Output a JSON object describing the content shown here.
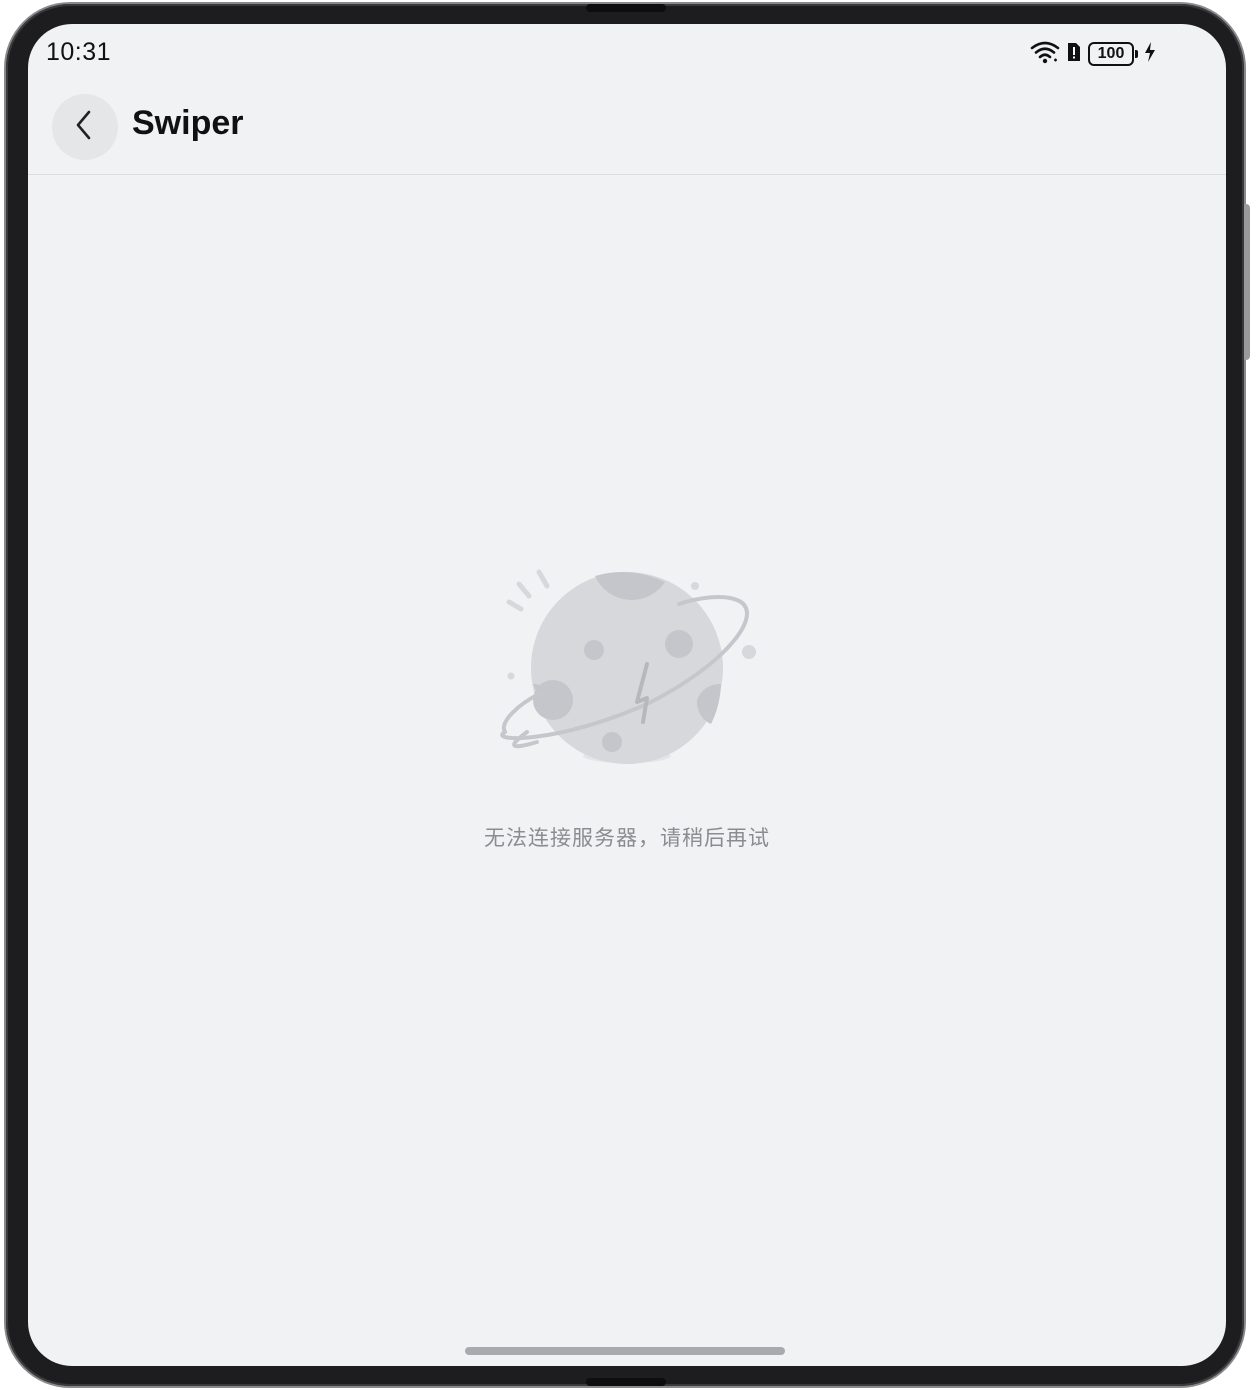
{
  "status_bar": {
    "time": "10:31",
    "battery_level": "100",
    "icons": [
      "wifi-icon",
      "sim-alert-icon",
      "battery-icon",
      "charging-icon"
    ]
  },
  "app_bar": {
    "title": "Swiper",
    "back_icon": "chevron-left-icon"
  },
  "empty_state": {
    "illustration": "disconnected-planet-icon",
    "message": "无法连接服务器，请稍后再试"
  },
  "colors": {
    "screen_background": "#f1f2f4",
    "title_text": "#111111",
    "message_text": "#8b8c8f",
    "illustration_fill": "#d7d8dc"
  }
}
